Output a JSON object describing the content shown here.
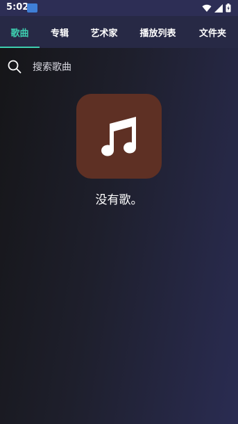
{
  "status_bar": {
    "time": "5:02",
    "icons": [
      "app-notification-icon",
      "wifi-icon",
      "cellular-signal-icon",
      "battery-icon"
    ]
  },
  "tabs": [
    {
      "label": "歌曲",
      "active": true
    },
    {
      "label": "专辑",
      "active": false
    },
    {
      "label": "艺术家",
      "active": false
    },
    {
      "label": "播放列表",
      "active": false
    },
    {
      "label": "文件夹",
      "active": false
    }
  ],
  "search": {
    "placeholder": "搜索歌曲",
    "icon": "search-icon"
  },
  "empty_state": {
    "icon": "music-note-icon",
    "message": "没有歌。"
  },
  "colors": {
    "accent": "#3ecfb0",
    "tab_bar": "#272945",
    "status_bar": "#2d2e55",
    "art_tile": "#5e3024"
  }
}
